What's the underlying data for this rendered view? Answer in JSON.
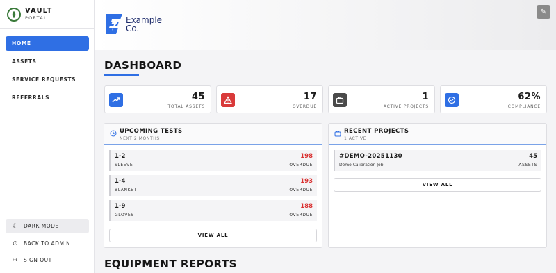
{
  "sidebar": {
    "brand_title": "VAULT",
    "brand_sub": "PORTAL",
    "nav": [
      {
        "label": "HOME"
      },
      {
        "label": "ASSETS"
      },
      {
        "label": "SERVICE REQUESTS"
      },
      {
        "label": "REFERRALS"
      }
    ],
    "dark_mode": "DARK MODE",
    "back_to_admin": "BACK TO ADMIN",
    "sign_out": "SIGN OUT"
  },
  "header": {
    "company_line1": "Example",
    "company_line2": "Co."
  },
  "main": {
    "title": "DASHBOARD",
    "stats": [
      {
        "value": "45",
        "label": "TOTAL ASSETS",
        "icon": "trending-up-icon",
        "color": "#2f6fe4"
      },
      {
        "value": "17",
        "label": "OVERDUE",
        "icon": "warning-icon",
        "color": "#d93a3a"
      },
      {
        "value": "1",
        "label": "ACTIVE PROJECTS",
        "icon": "briefcase-icon",
        "color": "#4a4a4a"
      },
      {
        "value": "62%",
        "label": "COMPLIANCE",
        "icon": "check-circle-icon",
        "color": "#2f6fe4"
      }
    ],
    "upcoming": {
      "title": "UPCOMING TESTS",
      "sub": "NEXT 2 MONTHS",
      "rows": [
        {
          "name": "1-2",
          "type": "SLEEVE",
          "count": "198",
          "status": "OVERDUE"
        },
        {
          "name": "1-4",
          "type": "BLANKET",
          "count": "193",
          "status": "OVERDUE"
        },
        {
          "name": "1-9",
          "type": "GLOVES",
          "count": "188",
          "status": "OVERDUE"
        }
      ],
      "view_all": "VIEW ALL"
    },
    "projects": {
      "title": "RECENT PROJECTS",
      "sub": "1 ACTIVE",
      "rows": [
        {
          "id": "#DEMO-20251130",
          "name": "Demo Calibration Job",
          "count": "45",
          "label": "ASSETS"
        }
      ],
      "view_all": "VIEW ALL"
    },
    "equipment_title": "EQUIPMENT REPORTS"
  }
}
